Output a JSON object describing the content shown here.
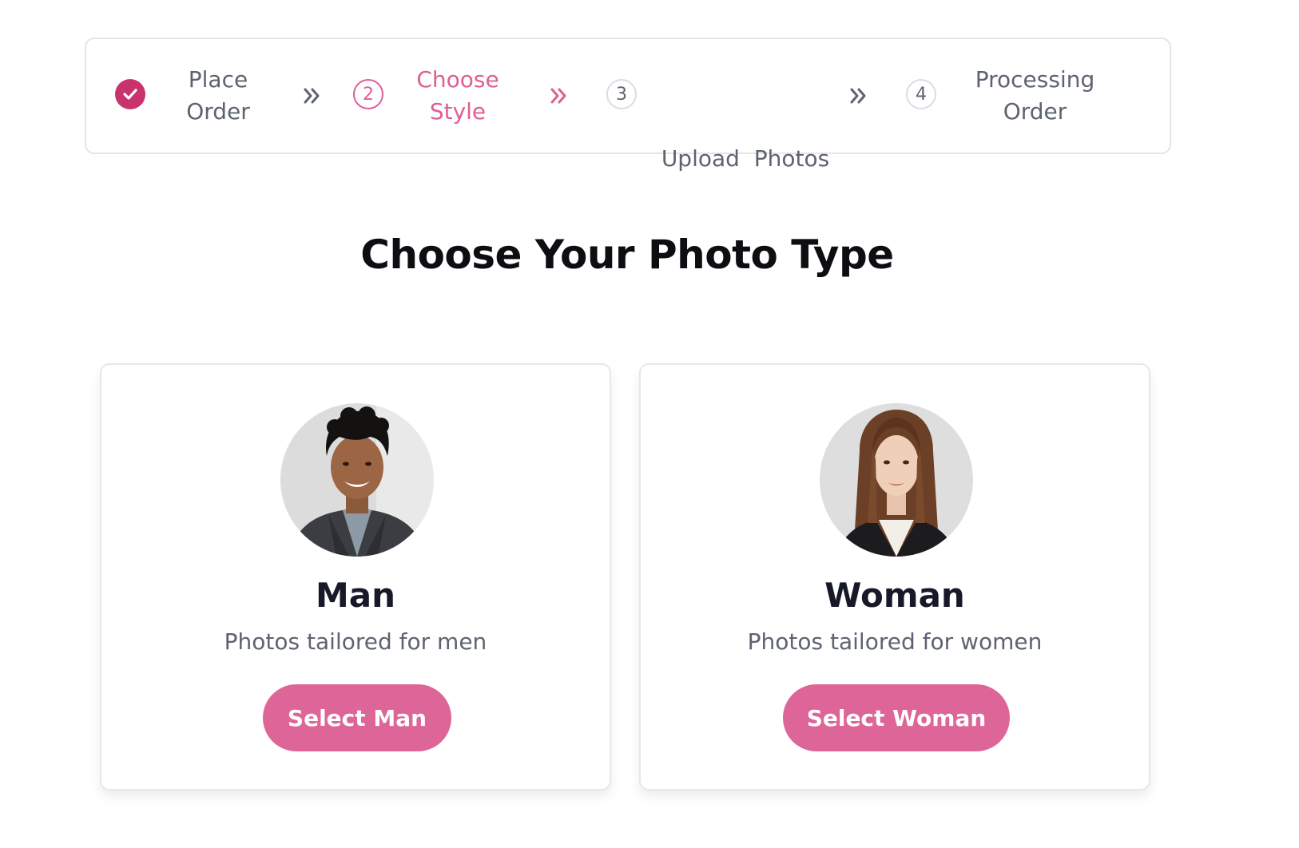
{
  "stepper": {
    "steps": [
      {
        "number": "",
        "label_line1": "Place",
        "label_line2": "Order",
        "state": "done",
        "icon": "check-icon"
      },
      {
        "number": "2",
        "label_line1": "Choose",
        "label_line2": "Style",
        "state": "active"
      },
      {
        "number": "3",
        "label_line1": "Upload  Photos",
        "label_line2": "",
        "state": "pending"
      },
      {
        "number": "4",
        "label_line1": "Processing",
        "label_line2": "Order",
        "state": "pending"
      }
    ],
    "separator_icon": "double-chevron-right-icon"
  },
  "heading": "Choose Your Photo Type",
  "cards": [
    {
      "title": "Man",
      "description": "Photos tailored for men",
      "button_label": "Select Man",
      "avatar_icon": "man-portrait"
    },
    {
      "title": "Woman",
      "description": "Photos tailored for women",
      "button_label": "Select Woman",
      "avatar_icon": "woman-portrait"
    }
  ],
  "colors": {
    "accent": "#de6597",
    "accent_dark": "#c8336e",
    "muted_text": "#5d6370",
    "heading_text": "#0d0d12"
  }
}
